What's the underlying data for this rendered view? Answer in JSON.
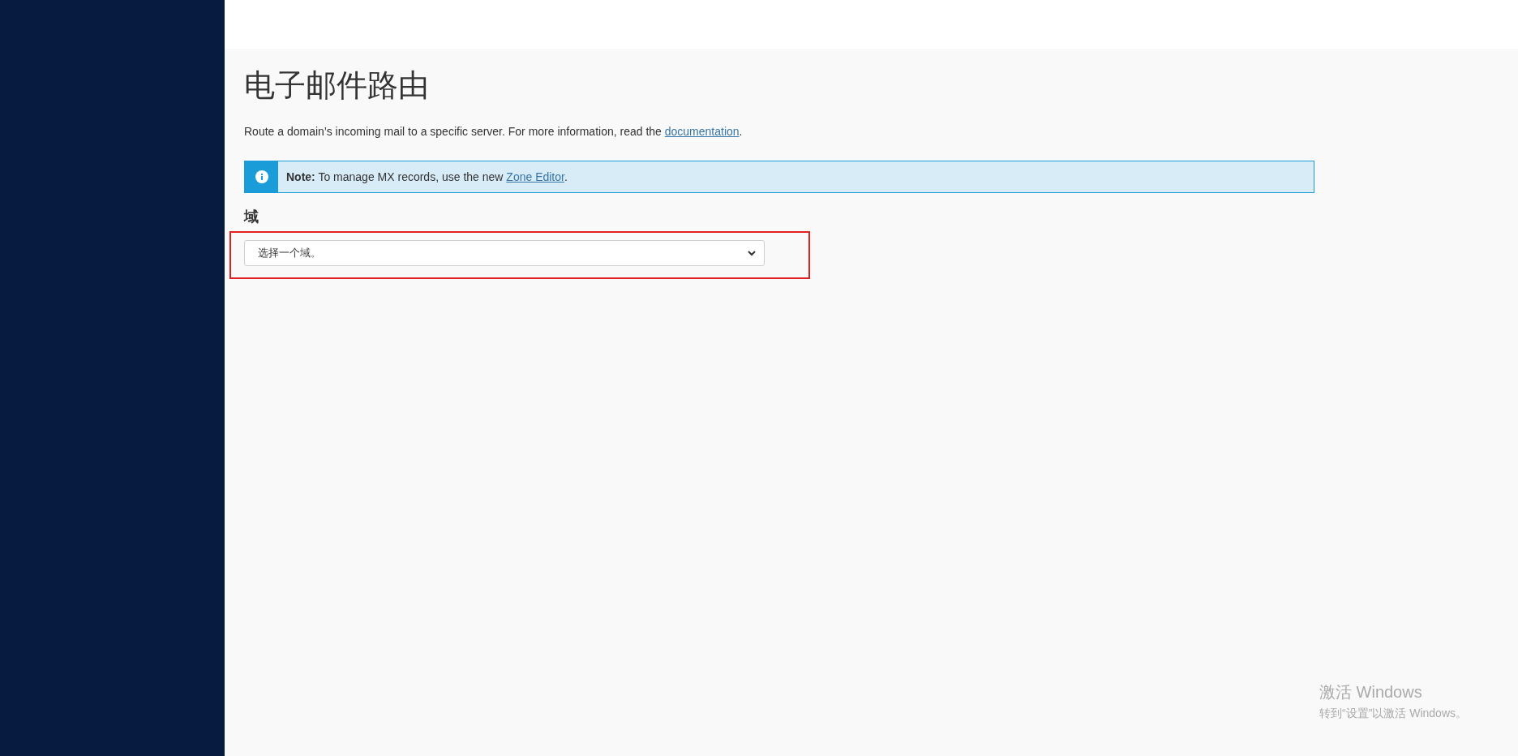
{
  "page": {
    "title": "电子邮件路由",
    "description": {
      "text": "Route a domain’s incoming mail to a specific server. For more information, read the ",
      "link": "documentation",
      "after": "."
    }
  },
  "note": {
    "text": "**Note:** To manage MX records, use the new ",
    "link": "Zone Editor",
    "after": "."
  },
  "domain_field": {
    "label": "域",
    "value": "选择一个域。",
    "highlighted": true
  },
  "activation_notice": {
    "title": "激活 Windows",
    "subtitle": "转到“设置”以激活 Windows。"
  }
}
